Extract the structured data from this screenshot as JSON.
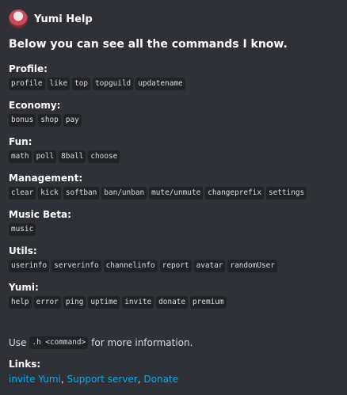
{
  "author": {
    "name": "Yumi Help"
  },
  "title": "Below you can see all the commands I know.",
  "fields": [
    {
      "name": "Profile:",
      "commands": [
        "profile",
        "like",
        "top",
        "topguild",
        "updatename"
      ]
    },
    {
      "name": "Economy:",
      "commands": [
        "bonus",
        "shop",
        "pay"
      ]
    },
    {
      "name": "Fun:",
      "commands": [
        "math",
        "poll",
        "8ball",
        "choose"
      ]
    },
    {
      "name": "Management:",
      "commands": [
        "clear",
        "kick",
        "softban",
        "ban/unban",
        "mute/unmute",
        "changeprefix",
        "settings"
      ]
    },
    {
      "name": "Music Beta:",
      "commands": [
        "music"
      ]
    },
    {
      "name": "Utils:",
      "commands": [
        "userinfo",
        "serverinfo",
        "channelinfo",
        "report",
        "avatar",
        "randomUser"
      ]
    },
    {
      "name": "Yumi:",
      "commands": [
        "help",
        "error",
        "ping",
        "uptime",
        "invite",
        "donate",
        "premium"
      ]
    }
  ],
  "footer": {
    "prefix": "Use",
    "code": ".h <command>",
    "suffix": "for more information."
  },
  "links": {
    "name": "Links:",
    "items": [
      "invite Yumi",
      "Support server",
      "Donate"
    ],
    "separator": ", "
  },
  "colors": {
    "background": "#2f3136",
    "link": "#00aff4",
    "code_bg": "#202225"
  }
}
